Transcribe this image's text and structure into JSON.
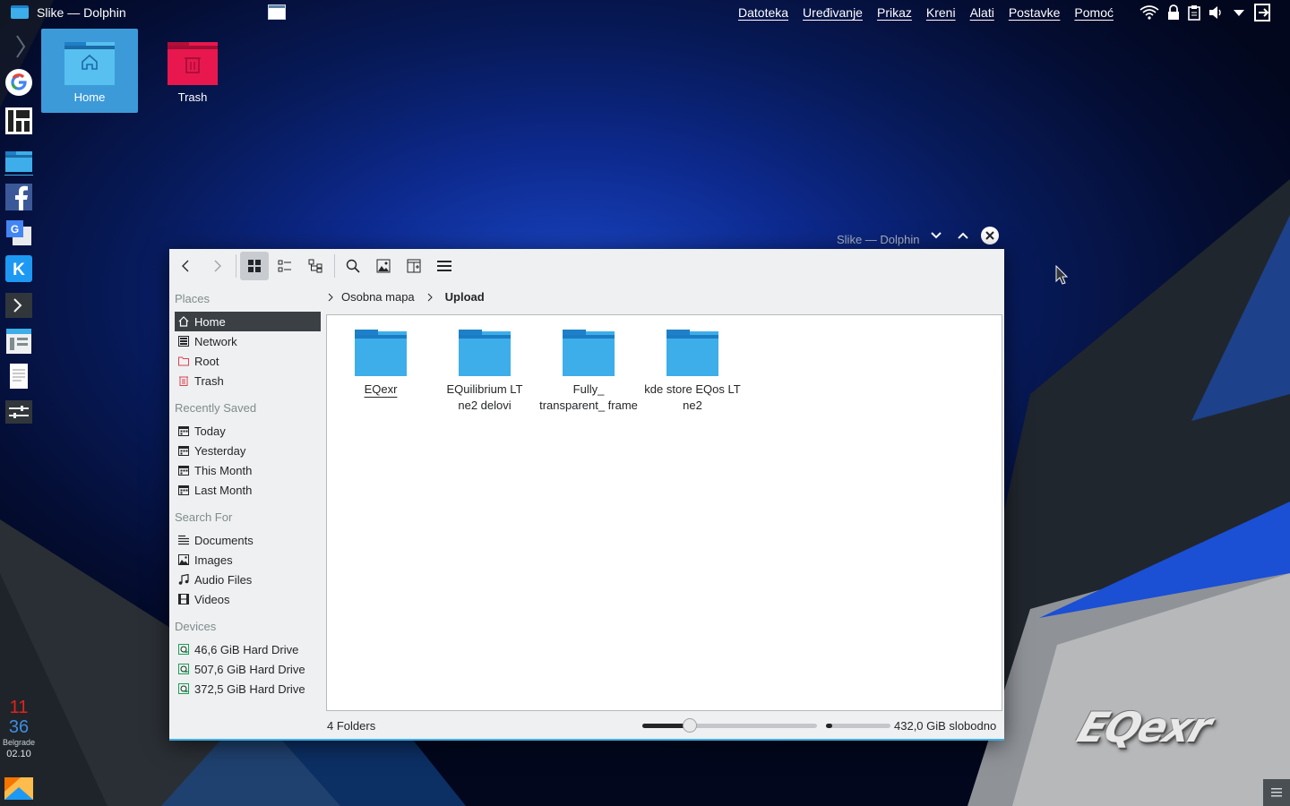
{
  "topbar": {
    "app_title": "Slike — Dolphin",
    "menus": [
      "Datoteka",
      "Uređivanje",
      "Prikaz",
      "Kreni",
      "Alati",
      "Postavke",
      "Pomoć"
    ]
  },
  "desktop_icons": [
    {
      "label": "Home",
      "selected": true
    },
    {
      "label": "Trash",
      "selected": false
    }
  ],
  "clock": {
    "hour": "11",
    "minute": "36",
    "city": "Belgrade",
    "date": "02.10"
  },
  "window": {
    "title": "Slike — Dolphin",
    "places": {
      "sections": {
        "places": "Places",
        "recent": "Recently Saved",
        "search": "Search For",
        "devices": "Devices"
      },
      "items": [
        {
          "label": "Home",
          "icon": "home-icon",
          "selected": true
        },
        {
          "label": "Network",
          "icon": "network-icon"
        },
        {
          "label": "Root",
          "icon": "folder-root-icon"
        },
        {
          "label": "Trash",
          "icon": "trash-icon"
        }
      ],
      "recent": [
        {
          "label": "Today"
        },
        {
          "label": "Yesterday"
        },
        {
          "label": "This Month"
        },
        {
          "label": "Last Month"
        }
      ],
      "search": [
        {
          "label": "Documents",
          "icon": "documents-icon"
        },
        {
          "label": "Images",
          "icon": "images-icon"
        },
        {
          "label": "Audio Files",
          "icon": "audio-icon"
        },
        {
          "label": "Videos",
          "icon": "videos-icon"
        }
      ],
      "devices": [
        {
          "label": "46,6 GiB Hard Drive"
        },
        {
          "label": "507,6 GiB Hard Drive"
        },
        {
          "label": "372,5 GiB Hard Drive"
        }
      ]
    },
    "breadcrumb": [
      "Osobna mapa",
      "Upload"
    ],
    "files": [
      {
        "name": "EQexr"
      },
      {
        "name": "EQuilibrium LT ne2 delovi"
      },
      {
        "name": "Fully_ transparent_ frame"
      },
      {
        "name": "kde store EQos LT ne2"
      }
    ],
    "status": {
      "count": "4 Folders",
      "free": "432,0 GiB slobodno",
      "zoom_fraction": 0.27,
      "disk_used_fraction": 0.1
    }
  },
  "logo_text": "EQexr",
  "colors": {
    "accent": "#3daee9",
    "folder": "#3daee9",
    "trash": "#e8184f",
    "selection": "#3b4045"
  }
}
